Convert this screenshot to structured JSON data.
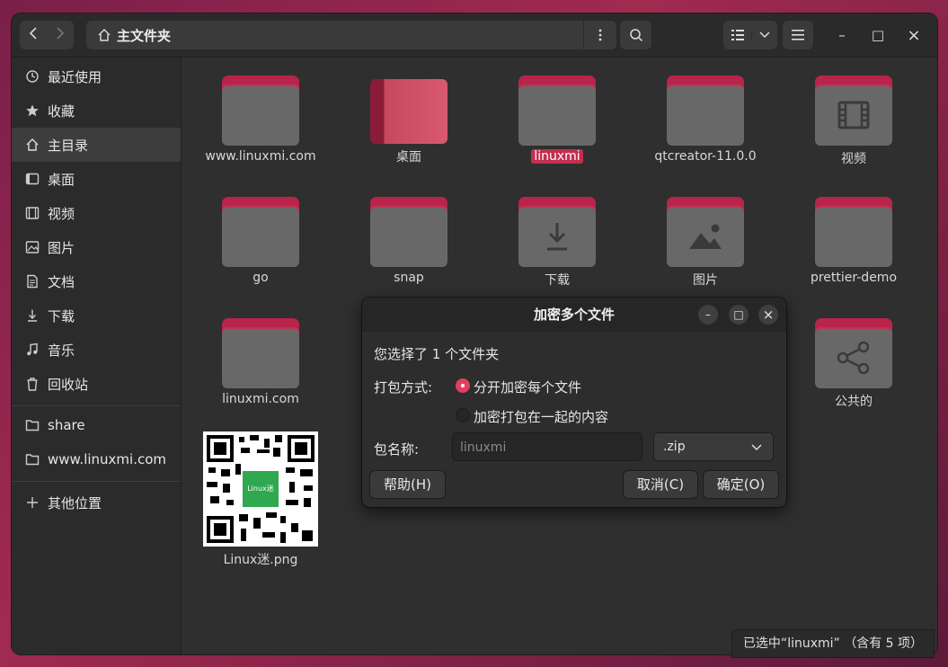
{
  "window": {
    "path_title": "主文件夹",
    "colors": {
      "accent": "#c2304f",
      "folder_tab": "#b8244a",
      "folder_body": "#686868"
    }
  },
  "header": {
    "back_icon": "chevron-left-icon",
    "forward_icon": "chevron-right-icon",
    "home_icon": "home-icon",
    "menu_icon": "kebab-menu-icon",
    "search_icon": "search-icon",
    "view_icon": "list-view-icon",
    "dropdown_icon": "chevron-down-icon",
    "hamburger_icon": "hamburger-icon",
    "minimize": "–",
    "maximize": "□",
    "close": "×"
  },
  "sidebar": {
    "items": [
      {
        "label": "最近使用",
        "icon": "clock-icon"
      },
      {
        "label": "收藏",
        "icon": "star-icon"
      },
      {
        "label": "主目录",
        "icon": "home-icon",
        "active": true
      },
      {
        "label": "桌面",
        "icon": "desktop-icon"
      },
      {
        "label": "视频",
        "icon": "film-icon"
      },
      {
        "label": "图片",
        "icon": "image-icon"
      },
      {
        "label": "文档",
        "icon": "document-icon"
      },
      {
        "label": "下载",
        "icon": "download-icon"
      },
      {
        "label": "音乐",
        "icon": "music-icon"
      },
      {
        "label": "回收站",
        "icon": "trash-icon"
      },
      {
        "label": "share",
        "icon": "folder-icon"
      },
      {
        "label": "www.linuxmi.com",
        "icon": "folder-icon"
      },
      {
        "label": "其他位置",
        "icon": "plus-icon"
      }
    ]
  },
  "files": [
    {
      "name": "www.linuxmi.com",
      "kind": "folder"
    },
    {
      "name": "桌面",
      "kind": "desktop"
    },
    {
      "name": "linuxmi",
      "kind": "folder",
      "selected": true
    },
    {
      "name": "qtcreator-11.0.0",
      "kind": "folder"
    },
    {
      "name": "视频",
      "kind": "folder",
      "glyph": "film-icon"
    },
    {
      "name": "go",
      "kind": "folder"
    },
    {
      "name": "snap",
      "kind": "folder"
    },
    {
      "name": "下载",
      "kind": "folder",
      "glyph": "download-icon"
    },
    {
      "name": "图片",
      "kind": "folder",
      "glyph": "image-icon"
    },
    {
      "name": "prettier-demo",
      "kind": "folder"
    },
    {
      "name": "linuxmi.com",
      "kind": "folder"
    },
    {
      "name": "公共的",
      "kind": "folder",
      "glyph": "share-icon"
    },
    {
      "name": "Linux迷.png",
      "kind": "image",
      "qr_center_text": "Linux迷"
    }
  ],
  "dialog": {
    "title": "加密多个文件",
    "minimize": "–",
    "maximize": "□",
    "close": "×",
    "summary": "您选择了 1 个文件夹",
    "pack_mode_label": "打包方式:",
    "option_separate": "分开加密每个文件",
    "option_together": "加密打包在一起的内容",
    "pack_name_label": "包名称:",
    "pack_name_placeholder": "linuxmi",
    "format_value": ".zip",
    "help_button": "帮助(H)",
    "cancel_button": "取消(C)",
    "ok_button": "确定(O)"
  },
  "status": {
    "text": "已选中“linuxmi” （含有 5 项）"
  }
}
